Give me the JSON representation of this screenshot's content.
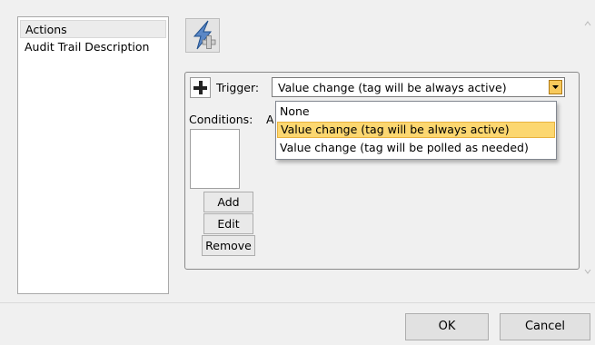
{
  "left_list": {
    "items": [
      {
        "label": "Actions",
        "selected": true
      },
      {
        "label": "Audit Trail Description",
        "selected": false
      }
    ]
  },
  "toolbar": {
    "add_action_icon": "lightning-plus-icon"
  },
  "trigger": {
    "label": "Trigger:",
    "value": "Value change (tag will be always active)",
    "options": [
      "None",
      "Value change (tag will be always active)",
      "Value change (tag will be polled as needed)"
    ],
    "selected_index": 1
  },
  "conditions": {
    "label": "Conditions:",
    "clipped_text": "A",
    "add_label": "Add",
    "edit_label": "Edit",
    "remove_label": "Remove"
  },
  "footer": {
    "ok_label": "OK",
    "cancel_label": "Cancel"
  },
  "colors": {
    "selected_option": "#fcd770",
    "dropdown_button": "#f7c95c",
    "list_selection": "#ececec"
  }
}
